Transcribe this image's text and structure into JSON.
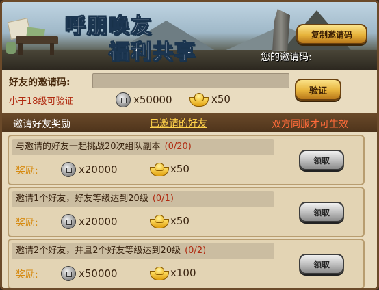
{
  "banner": {
    "title_line1": "呼朋唤友",
    "title_line2": "福利共享",
    "copy_button": "复制邀请码",
    "my_code_label": "您的邀请码:"
  },
  "invite": {
    "label": "好友的邀请码:",
    "input_value": "",
    "condition": "小于18级可验证",
    "coins": "x50000",
    "gold": "x50",
    "verify_button": "验证"
  },
  "tabs": {
    "rewards": "邀请好友奖励",
    "invited": "已邀请的好友",
    "note": "双方同服才可生效"
  },
  "tasks": [
    {
      "text": "与邀请的好友一起挑战20次组队副本",
      "progress": "(0/20)",
      "reward_label": "奖励:",
      "coins": "x20000",
      "gold": "x50",
      "button": "领取"
    },
    {
      "text": "邀请1个好友，好友等级达到20级",
      "progress": "(0/1)",
      "reward_label": "奖励:",
      "coins": "x20000",
      "gold": "x50",
      "button": "领取"
    },
    {
      "text": "邀请2个好友，并且2个好友等级达到20级",
      "progress": "(0/2)",
      "reward_label": "奖励:",
      "coins": "x50000",
      "gold": "x100",
      "button": "领取"
    }
  ],
  "icons": {
    "coin": "copper-coin-icon",
    "gold": "gold-ingot-icon"
  }
}
